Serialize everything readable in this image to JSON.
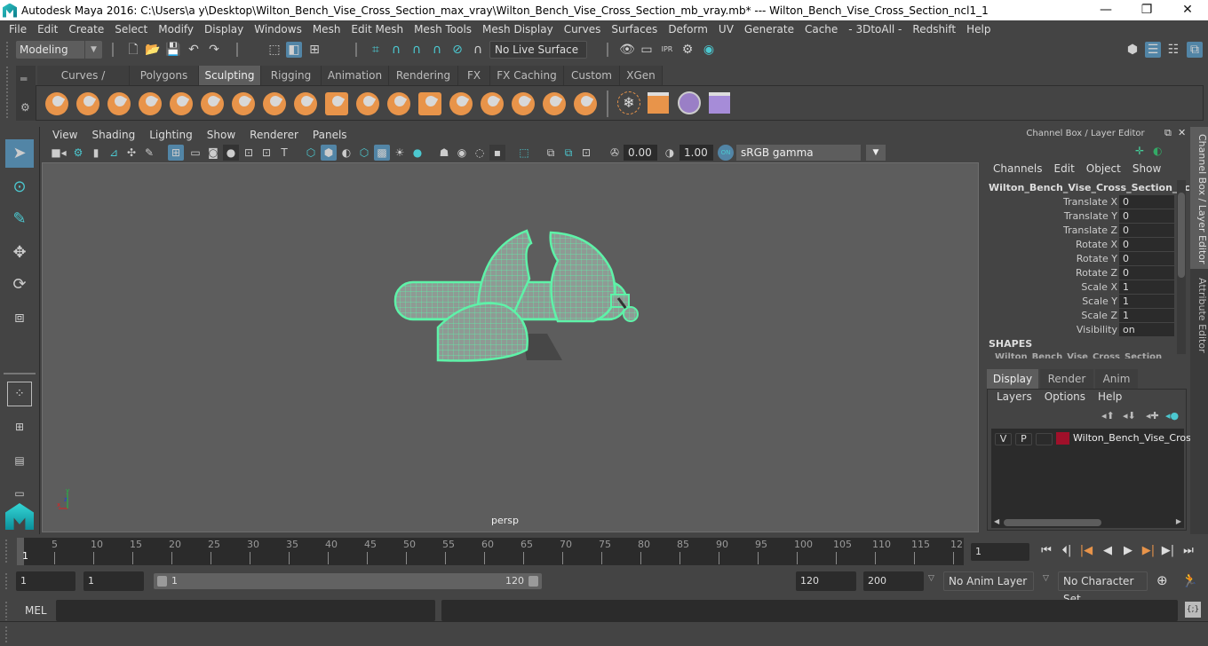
{
  "window": {
    "title": "Autodesk Maya 2016: C:\\Users\\a y\\Desktop\\Wilton_Bench_Vise_Cross_Section_max_vray\\Wilton_Bench_Vise_Cross_Section_mb_vray.mb*   ---   Wilton_Bench_Vise_Cross_Section_ncl1_1",
    "minimize": "—",
    "maximize": "❐",
    "close": "✕"
  },
  "menubar": [
    "File",
    "Edit",
    "Create",
    "Select",
    "Modify",
    "Display",
    "Windows",
    "Mesh",
    "Edit Mesh",
    "Mesh Tools",
    "Mesh Display",
    "Curves",
    "Surfaces",
    "Deform",
    "UV",
    "Generate",
    "Cache",
    "- 3DtoAll -",
    "Redshift",
    "Help"
  ],
  "statusline": {
    "mode": "Modeling",
    "live_surface": "No Live Surface"
  },
  "shelf": {
    "tabs": [
      "Curves / Surfaces",
      "Polygons",
      "Sculpting",
      "Rigging",
      "Animation",
      "Rendering",
      "FX",
      "FX Caching",
      "Custom",
      "XGen"
    ],
    "active_tab": "Sculpting",
    "tools": [
      "sculpt",
      "smooth",
      "relax",
      "grab",
      "pinch",
      "flatten",
      "foamy",
      "spray",
      "repeat",
      "imprint",
      "wax",
      "scrape",
      "fill",
      "knife",
      "smear",
      "bulge",
      "amplify",
      "freeze"
    ]
  },
  "viewport": {
    "menus": [
      "View",
      "Shading",
      "Lighting",
      "Show",
      "Renderer",
      "Panels"
    ],
    "exposure": "0.00",
    "gamma": "1.00",
    "color_mgmt": "ON",
    "color_space": "sRGB gamma",
    "camera": "persp",
    "axis": {
      "x": "x",
      "y": "y",
      "z": "z"
    },
    "wire_color": "#5ef2a8"
  },
  "channel_box": {
    "title": "Channel Box / Layer Editor",
    "menus": [
      "Channels",
      "Edit",
      "Object",
      "Show"
    ],
    "object_name": "Wilton_Bench_Vise_Cross_Section_ncl...",
    "attributes": [
      {
        "label": "Translate X",
        "value": "0"
      },
      {
        "label": "Translate Y",
        "value": "0"
      },
      {
        "label": "Translate Z",
        "value": "0"
      },
      {
        "label": "Rotate X",
        "value": "0"
      },
      {
        "label": "Rotate Y",
        "value": "0"
      },
      {
        "label": "Rotate Z",
        "value": "0"
      },
      {
        "label": "Scale X",
        "value": "1"
      },
      {
        "label": "Scale Y",
        "value": "1"
      },
      {
        "label": "Scale Z",
        "value": "1"
      },
      {
        "label": "Visibility",
        "value": "on"
      }
    ],
    "shapes_label": "SHAPES",
    "shapes_item": "Wilton_Bench_Vise_Cross_Section_n..."
  },
  "layer_editor": {
    "tabs": [
      "Display",
      "Render",
      "Anim"
    ],
    "active_tab": "Display",
    "menus": [
      "Layers",
      "Options",
      "Help"
    ],
    "layers": [
      {
        "v": "V",
        "p": "P",
        "color": "#a0102a",
        "name": "Wilton_Bench_Vise_Cross"
      }
    ]
  },
  "side_tabs": [
    "Channel Box / Layer Editor",
    "Attribute Editor"
  ],
  "timeline": {
    "ticks": [
      "5",
      "10",
      "15",
      "20",
      "25",
      "30",
      "35",
      "40",
      "45",
      "50",
      "55",
      "60",
      "65",
      "70",
      "75",
      "80",
      "85",
      "90",
      "95",
      "100",
      "105",
      "110",
      "115",
      "12"
    ],
    "current_frame_label": "1",
    "current_frame": "1",
    "playback_buttons": [
      "go-to-start",
      "step-back-key",
      "prev-key",
      "play-back",
      "play-forward",
      "next-key",
      "step-forward",
      "go-to-end"
    ]
  },
  "range": {
    "start": "1",
    "playback_start": "1",
    "range_min_label": "1",
    "range_max_label": "120",
    "playback_end": "120",
    "end": "200",
    "anim_layer": "No Anim Layer",
    "character_set": "No Character Set"
  },
  "command_line": {
    "label": "MEL",
    "input": "",
    "result": ""
  }
}
